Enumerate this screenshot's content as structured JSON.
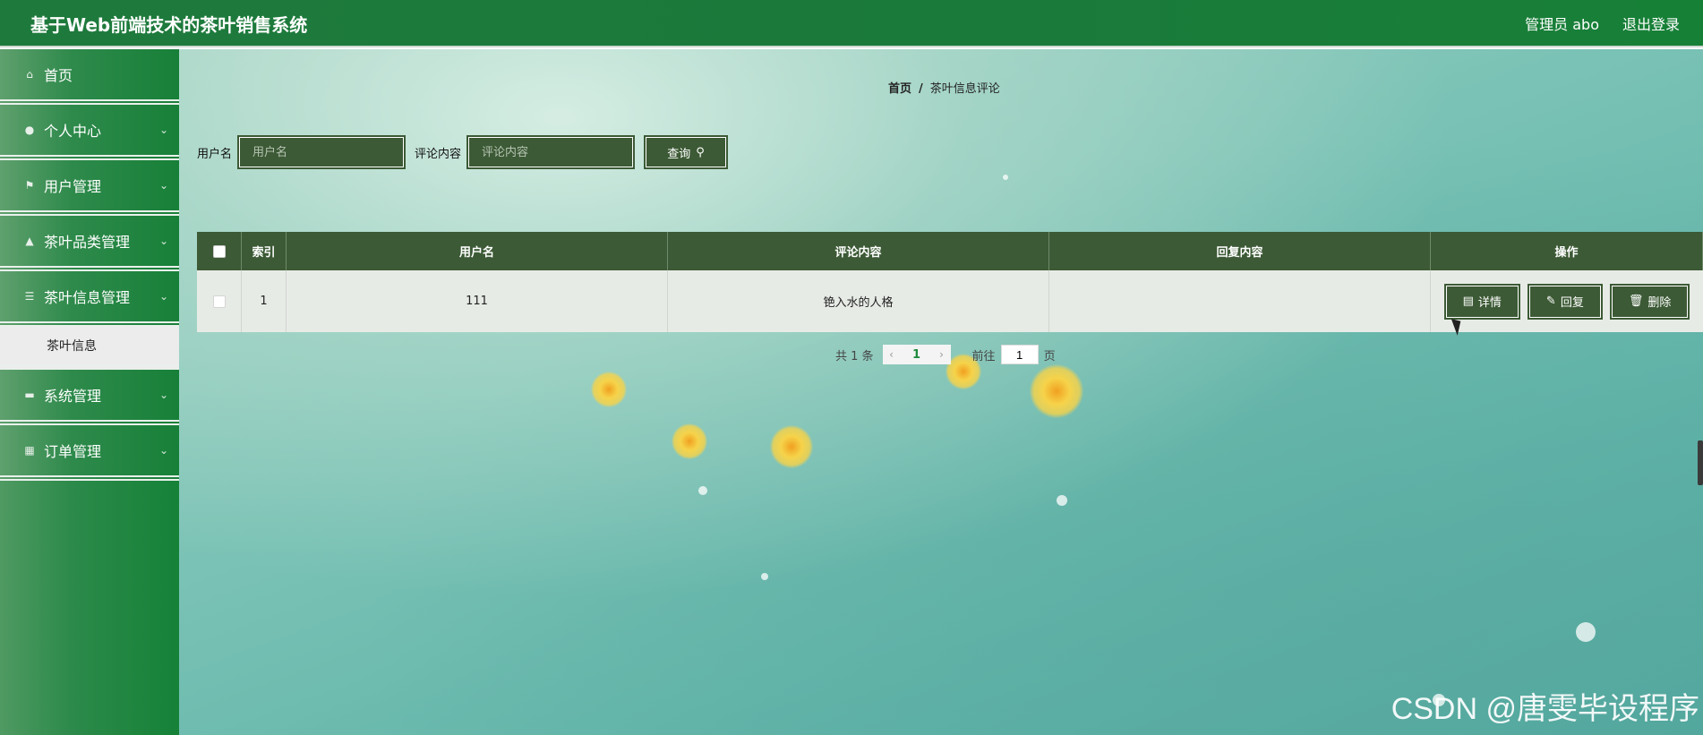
{
  "header": {
    "title": "基于Web前端技术的茶叶销售系统",
    "user": "管理员 abo",
    "logout": "退出登录"
  },
  "sidebar": {
    "items": [
      {
        "label": "首页",
        "icon": "home-icon"
      },
      {
        "label": "个人中心",
        "icon": "user-icon"
      },
      {
        "label": "用户管理",
        "icon": "flag-icon"
      },
      {
        "label": "茶叶品类管理",
        "icon": "thumb-icon"
      },
      {
        "label": "茶叶信息管理",
        "icon": "list-icon"
      },
      {
        "label": "茶叶信息",
        "sub": true
      },
      {
        "label": "系统管理",
        "icon": "chat-icon"
      },
      {
        "label": "订单管理",
        "icon": "grid-icon"
      }
    ]
  },
  "breadcrumb": {
    "home": "首页",
    "separator": "/",
    "current": "茶叶信息评论"
  },
  "search": {
    "username_label": "用户名",
    "username_placeholder": "用户名",
    "comment_label": "评论内容",
    "comment_placeholder": "评论内容",
    "query_button": "查询"
  },
  "table": {
    "headers": {
      "index": "索引",
      "username": "用户名",
      "comment": "评论内容",
      "reply": "回复内容",
      "ops": "操作"
    },
    "rows": [
      {
        "index": "1",
        "username": "111",
        "comment": "铯入水的人格",
        "reply": ""
      }
    ],
    "ops": {
      "detail": "详情",
      "reply": "回复",
      "delete": "删除"
    }
  },
  "pagination": {
    "total": "共 1 条",
    "current_page": "1",
    "goto_label": "前往",
    "goto_value": "1",
    "page_suffix": "页"
  },
  "watermark": "CSDN @唐雯毕设程序"
}
